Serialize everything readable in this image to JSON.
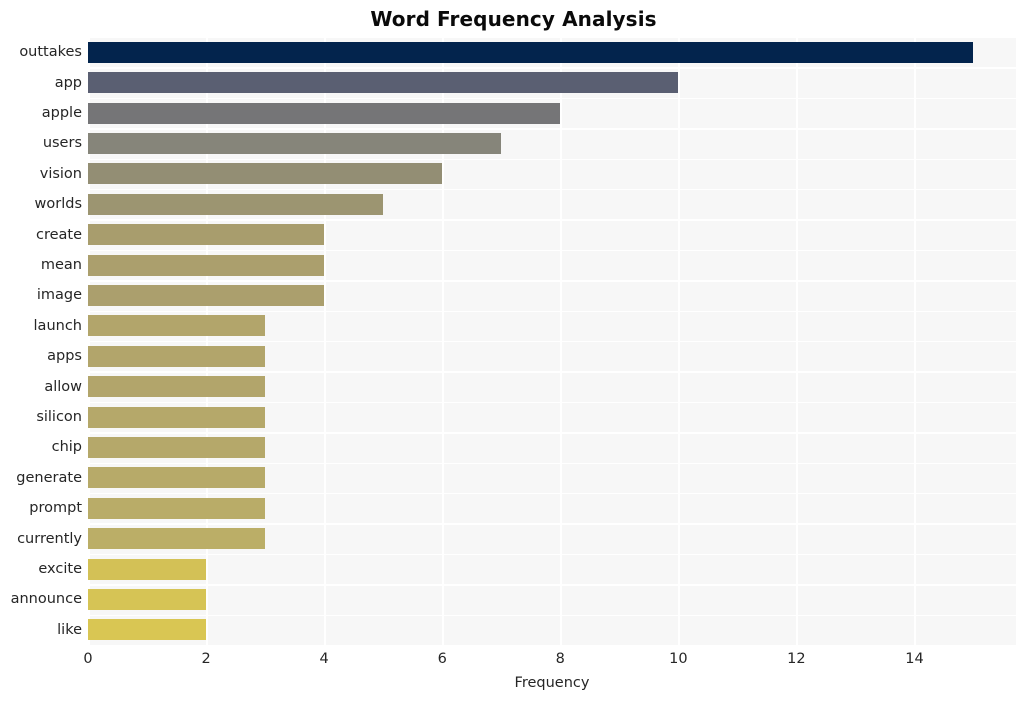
{
  "chart_data": {
    "type": "bar",
    "orientation": "horizontal",
    "title": "Word Frequency Analysis",
    "xlabel": "Frequency",
    "ylabel": "",
    "categories": [
      "outtakes",
      "app",
      "apple",
      "users",
      "vision",
      "worlds",
      "create",
      "mean",
      "image",
      "launch",
      "apps",
      "allow",
      "silicon",
      "chip",
      "generate",
      "prompt",
      "currently",
      "excite",
      "announce",
      "like"
    ],
    "values": [
      15,
      10,
      8,
      7,
      6,
      5,
      4,
      4,
      4,
      3,
      3,
      3,
      3,
      3,
      3,
      3,
      3,
      2,
      2,
      2
    ],
    "bar_colors": [
      "#03244d",
      "#5a5f72",
      "#757577",
      "#86857a",
      "#938e74",
      "#9c9571",
      "#a89d6d",
      "#ab9f6d",
      "#ab9f6d",
      "#b2a56b",
      "#b2a56b",
      "#b2a56b",
      "#b5a86a",
      "#b5a86a",
      "#b7aa69",
      "#b9ac68",
      "#bbae67",
      "#d3c156",
      "#d6c455",
      "#d9c653"
    ],
    "xlim": [
      0,
      15.72
    ],
    "ylim_categories_top_to_bottom": true,
    "xticks": [
      0,
      2,
      4,
      6,
      8,
      10,
      12,
      14
    ],
    "xtick_labels": [
      "0",
      "2",
      "4",
      "6",
      "8",
      "10",
      "12",
      "14"
    ],
    "grid": {
      "vertical": true,
      "horizontal": true,
      "color": "#ffffff"
    },
    "legend": null,
    "plot_background": "#f7f7f7",
    "figure_background": "#ffffff"
  }
}
